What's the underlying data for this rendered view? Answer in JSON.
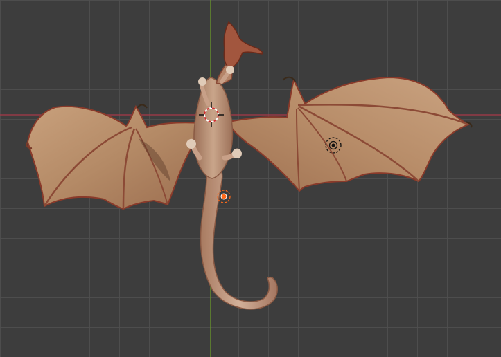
{
  "viewport": {
    "view": "top-orthographic",
    "grid": true,
    "colors": {
      "background": "#3d3d3d",
      "grid_line": "#505050",
      "x_axis": "#a83a48",
      "y_axis": "#6a9a2a",
      "selection_origin": "#ff6a1a",
      "light_icon": "#111111",
      "cursor_ring_red": "#d03030",
      "cursor_ring_white": "#ffffff"
    },
    "objects": [
      {
        "name": "dragon",
        "type": "mesh"
      },
      {
        "name": "light",
        "type": "lamp"
      }
    ],
    "icons": [
      "3d-cursor-icon",
      "object-origin-icon",
      "light-icon"
    ]
  }
}
